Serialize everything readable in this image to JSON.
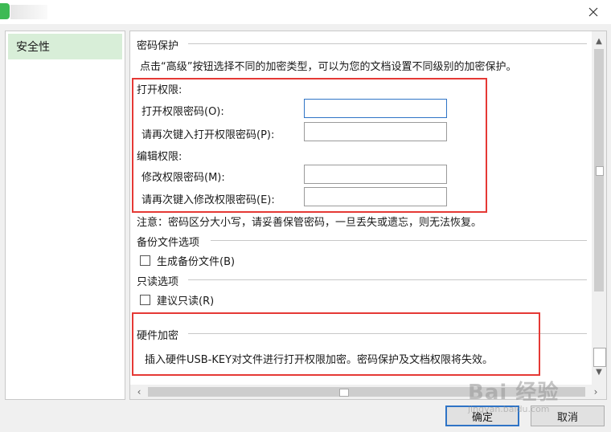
{
  "sidebar": {
    "items": [
      {
        "label": "安全性"
      }
    ]
  },
  "password": {
    "section_title": "密码保护",
    "description": "点击“高级”按钮选择不同的加密类型，可以为您的文档设置不同级别的加密保护。",
    "open_header": "打开权限:",
    "open_password_label": "打开权限密码(O):",
    "open_password_confirm_label": "请再次键入打开权限密码(P):",
    "edit_header": "编辑权限:",
    "edit_password_label": "修改权限密码(M):",
    "edit_password_confirm_label": "请再次键入修改权限密码(E):",
    "note": "注意：密码区分大小写，请妥善保管密码，一旦丢失或遗忘，则无法恢复。"
  },
  "backup": {
    "section_title": "备份文件选项",
    "checkbox_label": "生成备份文件(B)",
    "checked": false
  },
  "readonly": {
    "section_title": "只读选项",
    "checkbox_label": "建议只读(R)",
    "checked": false
  },
  "hardware": {
    "section_title": "硬件加密",
    "description": "插入硬件USB-KEY对文件进行打开权限加密。密码保护及文档权限将失效。"
  },
  "buttons": {
    "ok": "确定",
    "cancel": "取消"
  },
  "watermark": {
    "main": "Bai 经验",
    "sub": "jingyan.baidu.com"
  },
  "colors": {
    "highlight_box": "#e53935",
    "selected_item": "#d8eed8",
    "focus_border": "#2f74c6"
  }
}
